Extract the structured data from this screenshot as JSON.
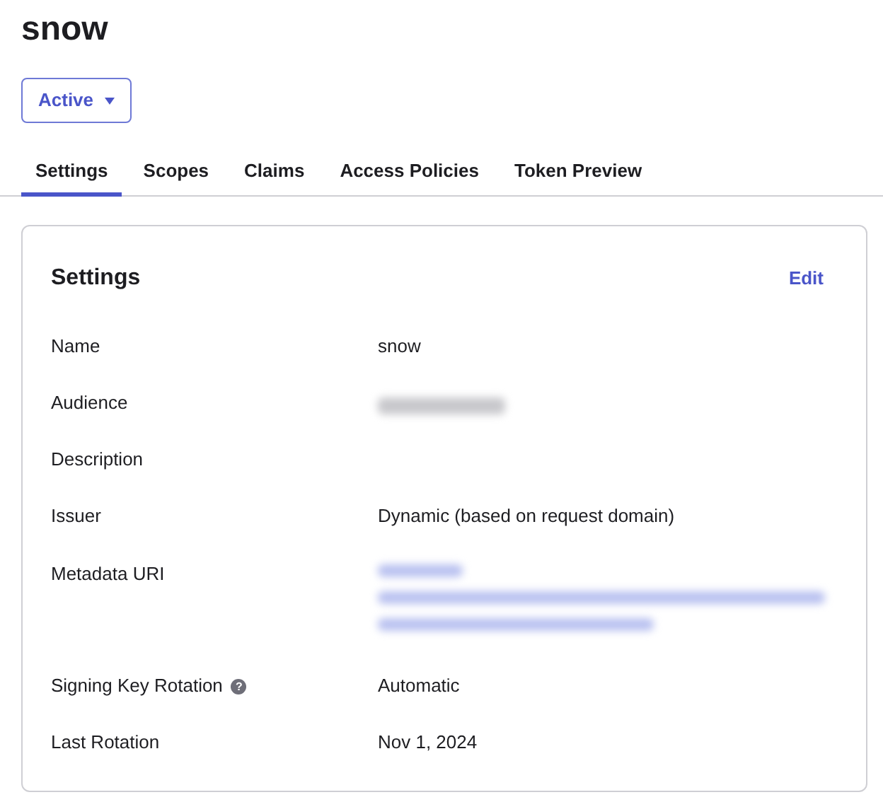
{
  "title": "snow",
  "status": {
    "label": "Active"
  },
  "tabs": [
    {
      "label": "Settings",
      "selected": true
    },
    {
      "label": "Scopes",
      "selected": false
    },
    {
      "label": "Claims",
      "selected": false
    },
    {
      "label": "Access Policies",
      "selected": false
    },
    {
      "label": "Token Preview",
      "selected": false
    }
  ],
  "card": {
    "title": "Settings",
    "action": "Edit",
    "rows": [
      {
        "kind": "text",
        "label": "Name",
        "value": "snow"
      },
      {
        "kind": "redacted",
        "label": "Audience"
      },
      {
        "kind": "empty",
        "label": "Description"
      },
      {
        "kind": "text",
        "label": "Issuer",
        "value": "Dynamic (based on request domain)"
      },
      {
        "kind": "redacted_link",
        "label": "Metadata URI"
      },
      {
        "kind": "text",
        "label": "Signing Key Rotation",
        "help": "?",
        "value": "Automatic"
      },
      {
        "kind": "text",
        "label": "Last Rotation",
        "value": "Nov 1, 2024"
      }
    ]
  }
}
